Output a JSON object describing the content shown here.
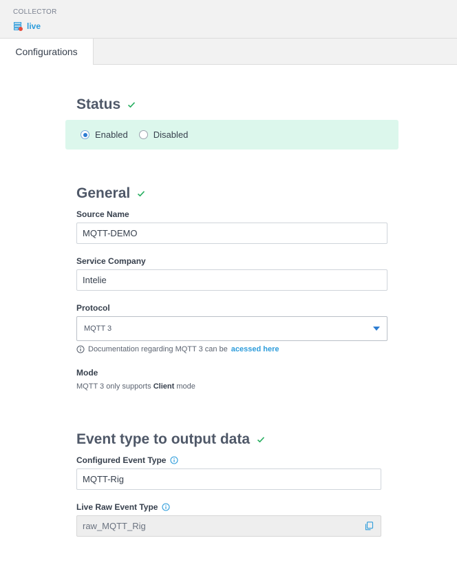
{
  "header": {
    "section_label": "COLLECTOR",
    "link_label": "live",
    "link_icon": "database-status-icon",
    "accent_color": "#2d9cdb",
    "status_dot_color": "#e74c3c"
  },
  "tabs": [
    {
      "label": "Configurations",
      "active": true
    }
  ],
  "status": {
    "title": "Status",
    "options": [
      {
        "label": "Enabled",
        "checked": true
      },
      {
        "label": "Disabled",
        "checked": false
      }
    ],
    "box_color": "#dcf7ec"
  },
  "general": {
    "title": "General",
    "source_name": {
      "label": "Source Name",
      "value": "MQTT-DEMO"
    },
    "service_company": {
      "label": "Service Company",
      "value": "Intelie"
    },
    "protocol": {
      "label": "Protocol",
      "selected": "MQTT 3",
      "note_text": "Documentation regarding MQTT 3 can be",
      "note_link": "acessed here"
    },
    "mode": {
      "label": "Mode",
      "text_before": "MQTT 3 only supports",
      "text_bold": "Client",
      "text_after": "mode"
    }
  },
  "event_type": {
    "title": "Event type to output data",
    "configured": {
      "label": "Configured Event Type",
      "value": "MQTT-Rig"
    },
    "live_raw": {
      "label": "Live Raw Event Type",
      "value": "raw_MQTT_Rig"
    }
  },
  "colors": {
    "check": "#27ae60",
    "primary": "#2d7dd2"
  }
}
